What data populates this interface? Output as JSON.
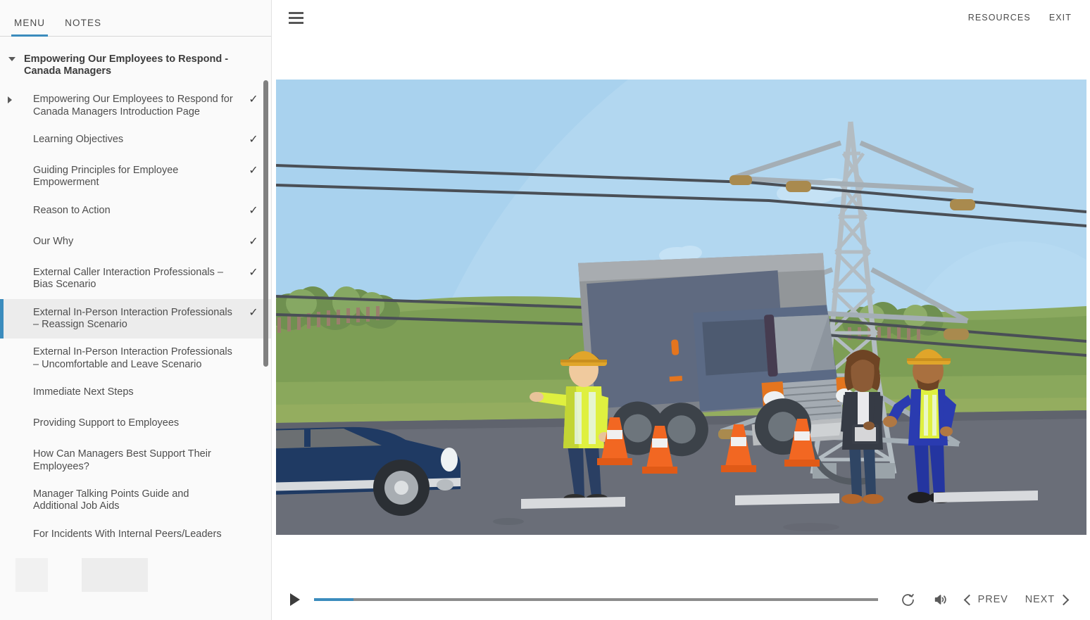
{
  "sidebar": {
    "tabs": [
      {
        "label": "MENU",
        "active": true
      },
      {
        "label": "NOTES",
        "active": false
      }
    ],
    "root": {
      "label": "Empowering Our Employees to Respond - Canada Managers",
      "expanded": true
    },
    "items": [
      {
        "label": "Empowering Our Employees to Respond for Canada Managers Introduction Page",
        "completed": true,
        "selected": false,
        "expandable": true
      },
      {
        "label": "Learning Objectives",
        "completed": true,
        "selected": false,
        "expandable": false
      },
      {
        "label": "Guiding Principles for Employee Empowerment",
        "completed": true,
        "selected": false,
        "expandable": false
      },
      {
        "label": "Reason to Action",
        "completed": true,
        "selected": false,
        "expandable": false
      },
      {
        "label": "Our Why",
        "completed": true,
        "selected": false,
        "expandable": false
      },
      {
        "label": "External Caller Interaction Professionals – Bias Scenario",
        "completed": true,
        "selected": false,
        "expandable": false
      },
      {
        "label": "External In-Person Interaction Professionals – Reassign Scenario",
        "completed": true,
        "selected": true,
        "expandable": false
      },
      {
        "label": "External In-Person Interaction Professionals – Uncomfortable and Leave Scenario",
        "completed": false,
        "selected": false,
        "expandable": false
      },
      {
        "label": "Immediate Next Steps",
        "completed": false,
        "selected": false,
        "expandable": false
      },
      {
        "label": "Providing Support to Employees",
        "completed": false,
        "selected": false,
        "expandable": false
      },
      {
        "label": "How Can Managers Best Support Their Employees?",
        "completed": false,
        "selected": false,
        "expandable": false
      },
      {
        "label": "Manager Talking Points Guide and Additional Job Aids",
        "completed": false,
        "selected": false,
        "expandable": false
      },
      {
        "label": "For Incidents With Internal Peers/Leaders",
        "completed": false,
        "selected": false,
        "expandable": false
      }
    ],
    "check_glyph": "✓"
  },
  "header": {
    "menu_icon": "hamburger-icon",
    "resources_label": "RESOURCES",
    "exit_label": "EXIT"
  },
  "player": {
    "play_icon": "play-icon",
    "replay_icon": "replay-icon",
    "volume_icon": "volume-icon",
    "prev_label": "PREV",
    "next_label": "NEXT",
    "progress_percent": 7
  },
  "colors": {
    "accent": "#3b8cbd",
    "sidebar_bg": "#fafafa",
    "selected_bg": "#ececec",
    "text": "#4e4e4e",
    "sky": "#a9d2ee",
    "grass": "#7d9a55",
    "hill": "#6f8f4c",
    "road": "#6a6e78",
    "truck_box": "#8f9396",
    "truck_cab": "#5b6a85",
    "cone": "#f26722",
    "car_blue": "#1f3a63",
    "hivis": "#d6e94a",
    "hardhat": "#e0a52a",
    "tower": "#b3bcc2"
  },
  "stage": {
    "scene_name": "truck-collision-with-power-line-scene",
    "elements": [
      "sky",
      "clouds",
      "hills",
      "tree-line",
      "fence",
      "transmission-tower",
      "power-lines",
      "box-truck",
      "traffic-cones",
      "worker-directing-traffic",
      "manager-with-clipboard",
      "field-worker",
      "blue-car",
      "road",
      "lane-markings",
      "downed-cable"
    ]
  }
}
